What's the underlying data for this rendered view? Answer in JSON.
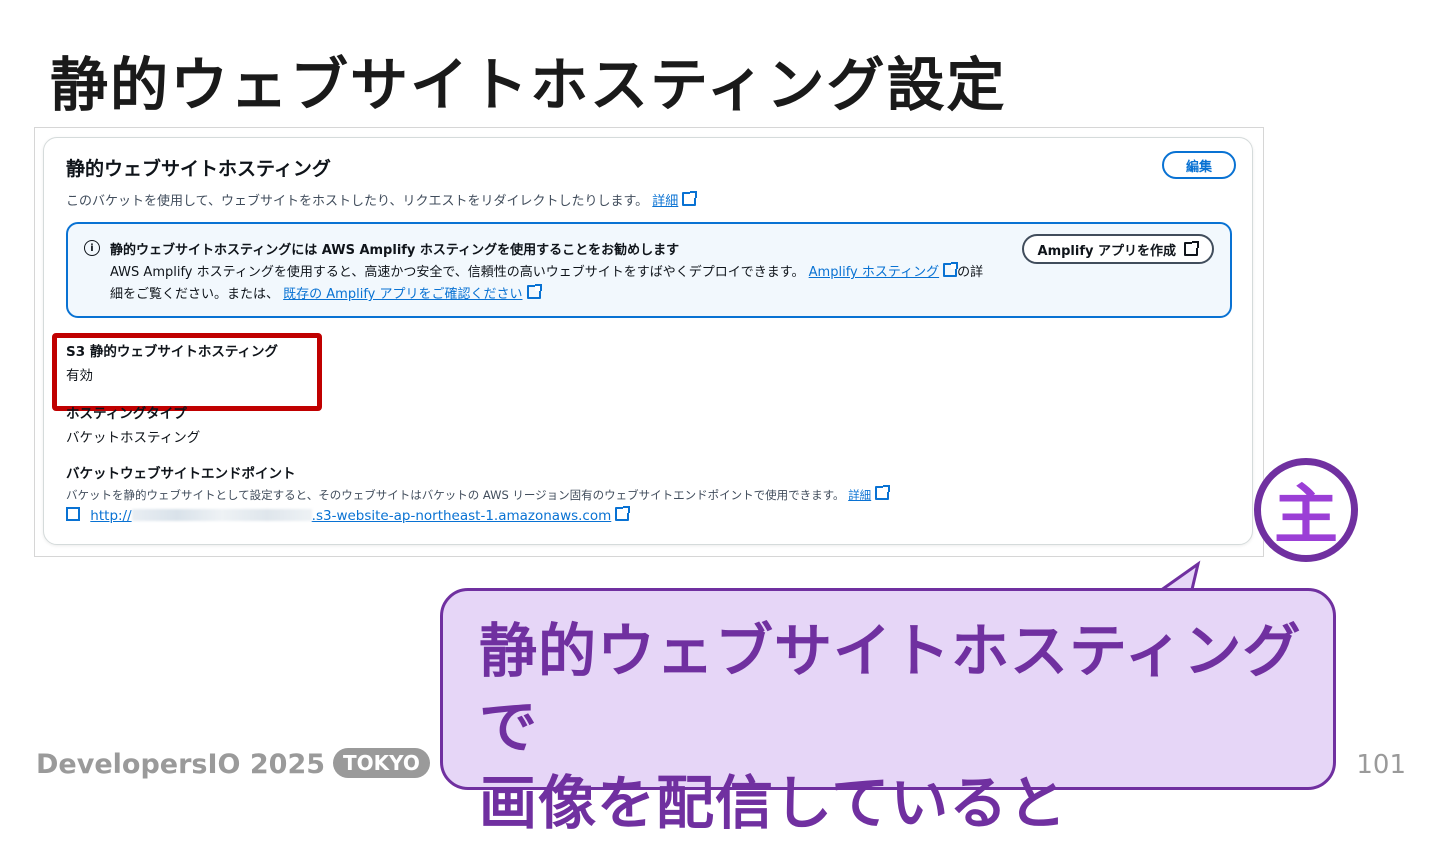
{
  "slide": {
    "title": "静的ウェブサイトホスティング設定",
    "brand": "DevelopersIO 2025",
    "brand_tag": "TOKYO",
    "page_number": "101",
    "badge_char": "主",
    "bubble_line1": "静的ウェブサイトホスティングで",
    "bubble_line2": "画像を配信していると"
  },
  "panel": {
    "title": "静的ウェブサイトホスティング",
    "description": "このバケットを使用して、ウェブサイトをホストしたり、リクエストをリダイレクトしたりします。",
    "details_link": "詳細",
    "edit_button": "編集"
  },
  "info": {
    "heading": "静的ウェブサイトホスティングには AWS Amplify ホスティングを使用することをお勧めします",
    "body_part1": "AWS Amplify ホスティングを使用すると、高速かつ安全で、信頼性の高いウェブサイトをすばやくデプロイできます。",
    "amplify_hosting_link": "Amplify ホスティング",
    "body_part2": "の詳細をご覧ください。または、",
    "existing_apps_link": "既存の Amplify アプリをご確認ください",
    "create_button": "Amplify アプリを作成"
  },
  "fields": {
    "s3_hosting_label": "S3 静的ウェブサイトホスティング",
    "s3_hosting_value": "有効",
    "hosting_type_label": "ホスティングタイプ",
    "hosting_type_value": "バケットホスティング",
    "endpoint_label": "バケットウェブサイトエンドポイント",
    "endpoint_note": "バケットを静的ウェブサイトとして設定すると、そのウェブサイトはバケットの AWS リージョン固有のウェブサイトエンドポイントで使用できます。",
    "endpoint_details_link": "詳細",
    "endpoint_prefix": "http://",
    "endpoint_suffix": ".s3-website-ap-northeast-1.amazonaws.com"
  },
  "colors": {
    "accent_blue": "#0972d3",
    "highlight_red": "#c00000",
    "callout_purple": "#7030a0",
    "callout_fill": "#e6d6f7"
  }
}
